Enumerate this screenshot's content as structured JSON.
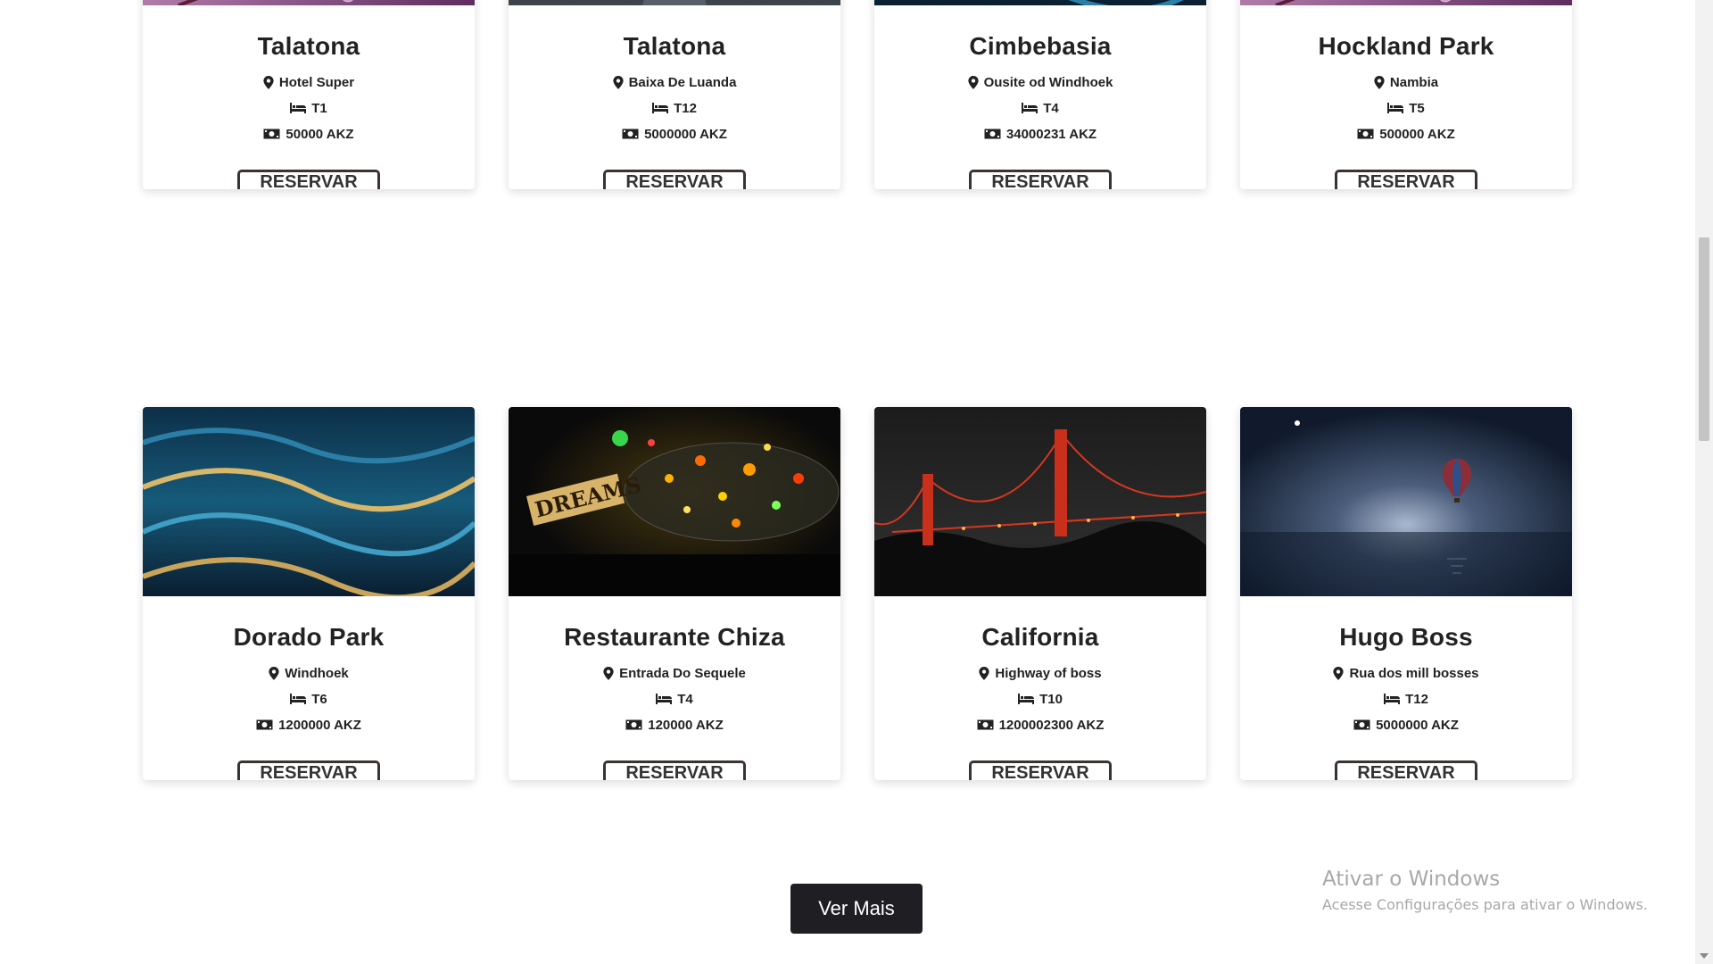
{
  "cards": [
    {
      "title": "Talatona",
      "location": "Hotel Super",
      "rooms": "T1",
      "price": "50000 AKZ",
      "button": "RESERVAR",
      "image": "purple-leaf-droplets"
    },
    {
      "title": "Talatona",
      "location": "Baixa De Luanda",
      "rooms": "T12",
      "price": "5000000 AKZ",
      "button": "RESERVAR",
      "image": "night-street"
    },
    {
      "title": "Cimbebasia",
      "location": "Ousite od Windhoek",
      "rooms": "T4",
      "price": "34000231 AKZ",
      "button": "RESERVAR",
      "image": "blue-waves"
    },
    {
      "title": "Hockland Park",
      "location": "Nambia",
      "rooms": "T5",
      "price": "500000 AKZ",
      "button": "RESERVAR",
      "image": "purple-leaf-droplets"
    },
    {
      "title": "Dorado Park",
      "location": "Windhoek",
      "rooms": "T6",
      "price": "1200000 AKZ",
      "button": "RESERVAR",
      "image": "blue-waves"
    },
    {
      "title": "Restaurante Chiza",
      "location": "Entrada Do Sequele",
      "rooms": "T4",
      "price": "120000 AKZ",
      "button": "RESERVAR",
      "image": "dreams-bottle-lights",
      "image_text": "DREAMS"
    },
    {
      "title": "California",
      "location": "Highway of boss",
      "rooms": "T10",
      "price": "1200002300 AKZ",
      "button": "RESERVAR",
      "image": "golden-gate-night"
    },
    {
      "title": "Hugo Boss",
      "location": "Rua dos mill bosses",
      "rooms": "T12",
      "price": "5000000 AKZ",
      "button": "RESERVAR",
      "image": "balloon-night-sea"
    }
  ],
  "icons": {
    "location": "map-pin-icon",
    "rooms": "bed-icon",
    "price": "money-bill-icon"
  },
  "more_button": "Ver Mais",
  "watermark": {
    "title": "Ativar o Windows",
    "subtitle": "Acesse Configurações para ativar o Windows."
  },
  "colors": {
    "button_border": "#3b3330",
    "more_button_bg": "#1f1f23",
    "watermark": "#a8a8a8"
  }
}
